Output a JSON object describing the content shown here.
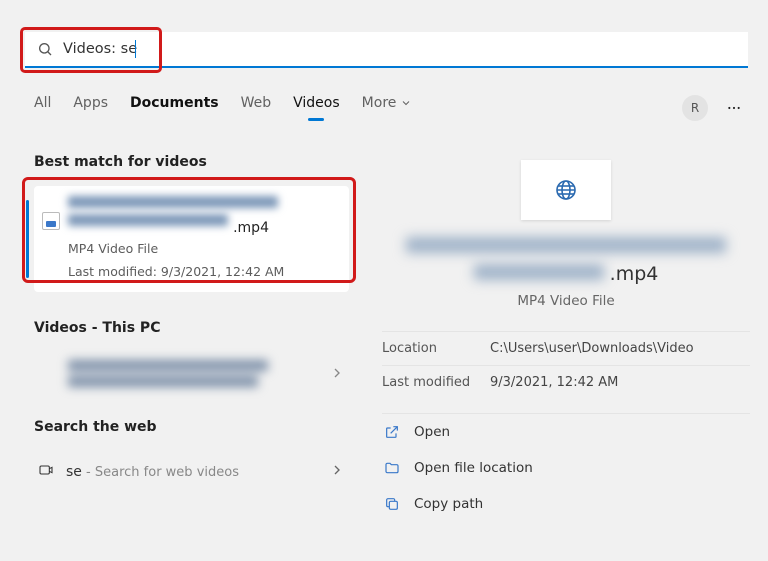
{
  "search": {
    "value_display": "Videos: se"
  },
  "tabs": {
    "all": "All",
    "apps": "Apps",
    "documents": "Documents",
    "web": "Web",
    "videos": "Videos",
    "more": "More"
  },
  "user_initial": "R",
  "sections": {
    "best_match": "Best match for videos",
    "videos_pc": "Videos - This PC",
    "search_web": "Search the web"
  },
  "best_match_item": {
    "filename_ext": ".mp4",
    "type_label": "MP4 Video File",
    "last_modified_label": "Last modified: 9/3/2021, 12:42 AM"
  },
  "web_item": {
    "term": "se",
    "hint": " - Search for web videos"
  },
  "preview": {
    "filename_ext": ".mp4",
    "type_label": "MP4 Video File",
    "details": {
      "location_label": "Location",
      "location_value": "C:\\Users\\user\\Downloads\\Video",
      "modified_label": "Last modified",
      "modified_value": "9/3/2021, 12:42 AM"
    },
    "actions": {
      "open": "Open",
      "open_location": "Open file location",
      "copy_path": "Copy path"
    }
  }
}
